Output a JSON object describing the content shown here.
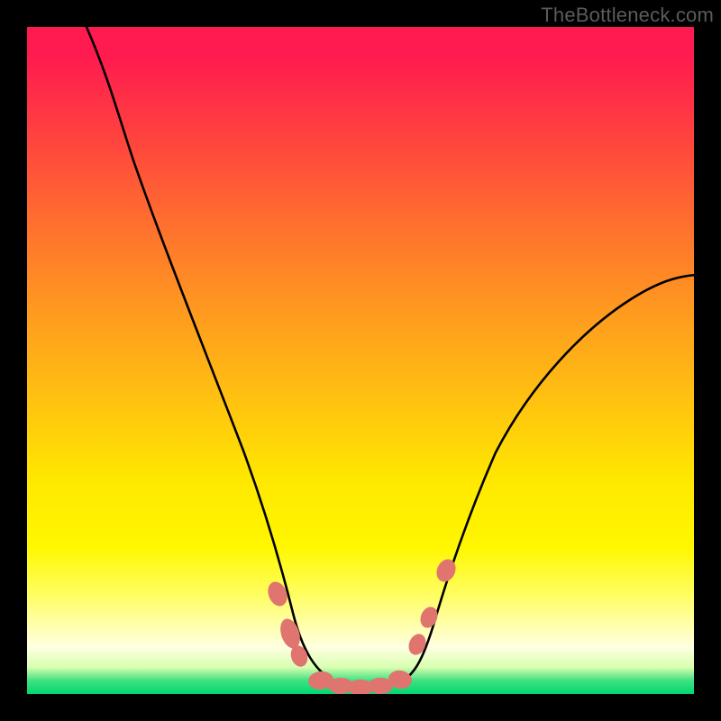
{
  "watermark": {
    "text": "TheBottleneck.com"
  },
  "colors": {
    "bg": "#000000",
    "watermark": "#5b5b5b",
    "curve": "#000000",
    "marker_fill": "#e0756f",
    "marker_stroke": "#c55a54"
  },
  "chart_data": {
    "type": "line",
    "title": "",
    "xlabel": "",
    "ylabel": "",
    "xlim": [
      0,
      100
    ],
    "ylim": [
      0,
      100
    ],
    "grid": false,
    "legend": false,
    "note": "Values below are normalised 0–100 in plot coordinates (y=0 at bottom, y=100 at top). No numeric axis labels are rendered in the image.",
    "series": [
      {
        "name": "bottleneck-curve",
        "x": [
          9,
          12,
          16,
          20,
          25,
          30,
          34,
          36,
          38,
          40,
          42,
          46,
          50,
          54,
          57,
          59,
          61,
          63,
          66,
          70,
          76,
          82,
          88,
          94,
          100
        ],
        "y": [
          100,
          91,
          80,
          68,
          54,
          41,
          28,
          20,
          13,
          7,
          4,
          1.5,
          1,
          1.5,
          3.5,
          7,
          12,
          18,
          26,
          35,
          44,
          50,
          55,
          59,
          62
        ]
      }
    ],
    "markers": {
      "name": "highlighted-points",
      "note": "Pink bead markers near curve minimum.",
      "points": [
        {
          "x": 37.5,
          "y": 15
        },
        {
          "x": 39.5,
          "y": 9
        },
        {
          "x": 40.8,
          "y": 6
        },
        {
          "x": 44.0,
          "y": 2.0
        },
        {
          "x": 47.0,
          "y": 1.2
        },
        {
          "x": 50.0,
          "y": 1.0
        },
        {
          "x": 53.0,
          "y": 1.2
        },
        {
          "x": 56.0,
          "y": 2.2
        },
        {
          "x": 58.5,
          "y": 7.5
        },
        {
          "x": 60.2,
          "y": 11.5
        },
        {
          "x": 62.8,
          "y": 18.5
        }
      ]
    }
  }
}
